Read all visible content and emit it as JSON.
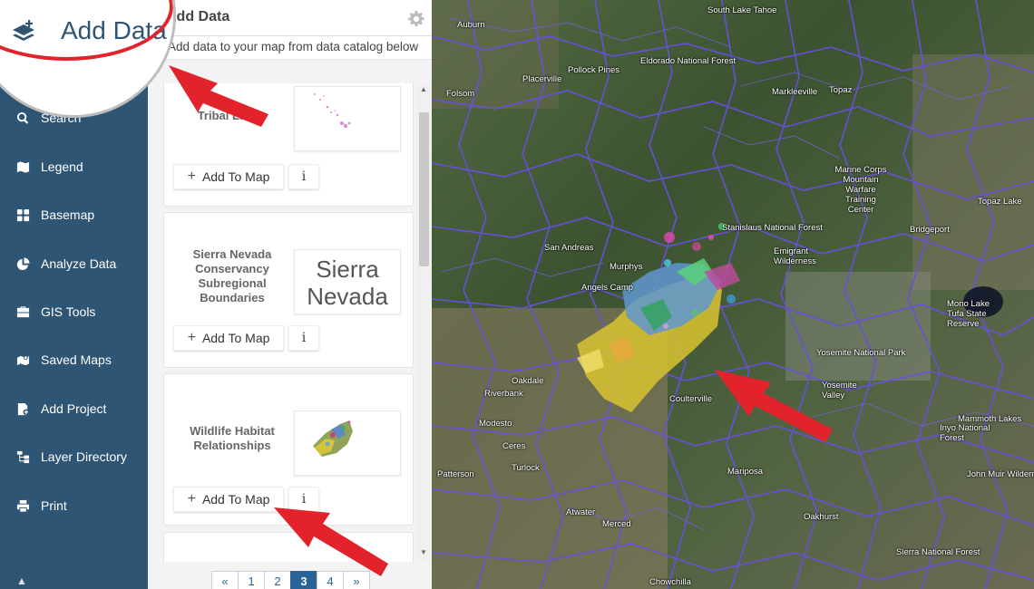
{
  "magnifier": {
    "title": "Add Data"
  },
  "sidebar": {
    "items": [
      {
        "label": "Search",
        "icon": "search-icon"
      },
      {
        "label": "Legend",
        "icon": "map-icon"
      },
      {
        "label": "Basemap",
        "icon": "grid-icon"
      },
      {
        "label": "Analyze Data",
        "icon": "pie-chart-icon"
      },
      {
        "label": "GIS Tools",
        "icon": "toolbox-icon"
      },
      {
        "label": "Saved Maps",
        "icon": "saved-maps-icon"
      },
      {
        "label": "Add Project",
        "icon": "add-project-icon"
      },
      {
        "label": "Layer Directory",
        "icon": "sitemap-icon"
      },
      {
        "label": "Print",
        "icon": "print-icon"
      }
    ]
  },
  "panel": {
    "title": "Add Data",
    "subtitle": "Add data to your map from data catalog below",
    "cards": [
      {
        "title": "Tribal Lands",
        "add_label": "Add To Map",
        "info_label": "i"
      },
      {
        "title": "Sierra Nevada Conservancy Subregional Boundaries",
        "thumb_text_1": "Sierra",
        "thumb_text_2": "Nevada",
        "add_label": "Add To Map",
        "info_label": "i"
      },
      {
        "title": "Wildlife Habitat Relationships",
        "add_label": "Add To Map",
        "info_label": "i"
      }
    ],
    "pagination": {
      "prev": "«",
      "pages": [
        "1",
        "2",
        "3",
        "4"
      ],
      "active": "3",
      "next": "»"
    }
  },
  "map": {
    "labels": [
      "South Lake Tahoe",
      "Auburn",
      "Eldorado National Forest",
      "Pollock Pines",
      "Placerville",
      "Folsom",
      "Markleeville",
      "Topaz",
      "Marine Corps Mountain Warfare Training Center",
      "Topaz Lake",
      "Bridgeport",
      "Stanislaus National Forest",
      "San Andreas",
      "Murphys",
      "Angels Camp",
      "Emigrant Wilderness",
      "Mono Lake Tufa State Reserve",
      "Yosemite National Park",
      "Oakdale",
      "Riverbank",
      "Yosemite Valley",
      "Coulterville",
      "Modesto",
      "Ceres",
      "Turlock",
      "Patterson",
      "Mariposa",
      "Mammoth Lakes",
      "Inyo National Forest",
      "John Muir Wilderness",
      "Atwater",
      "Merced",
      "Oakhurst",
      "Chowchilla",
      "Sierra National Forest"
    ]
  }
}
